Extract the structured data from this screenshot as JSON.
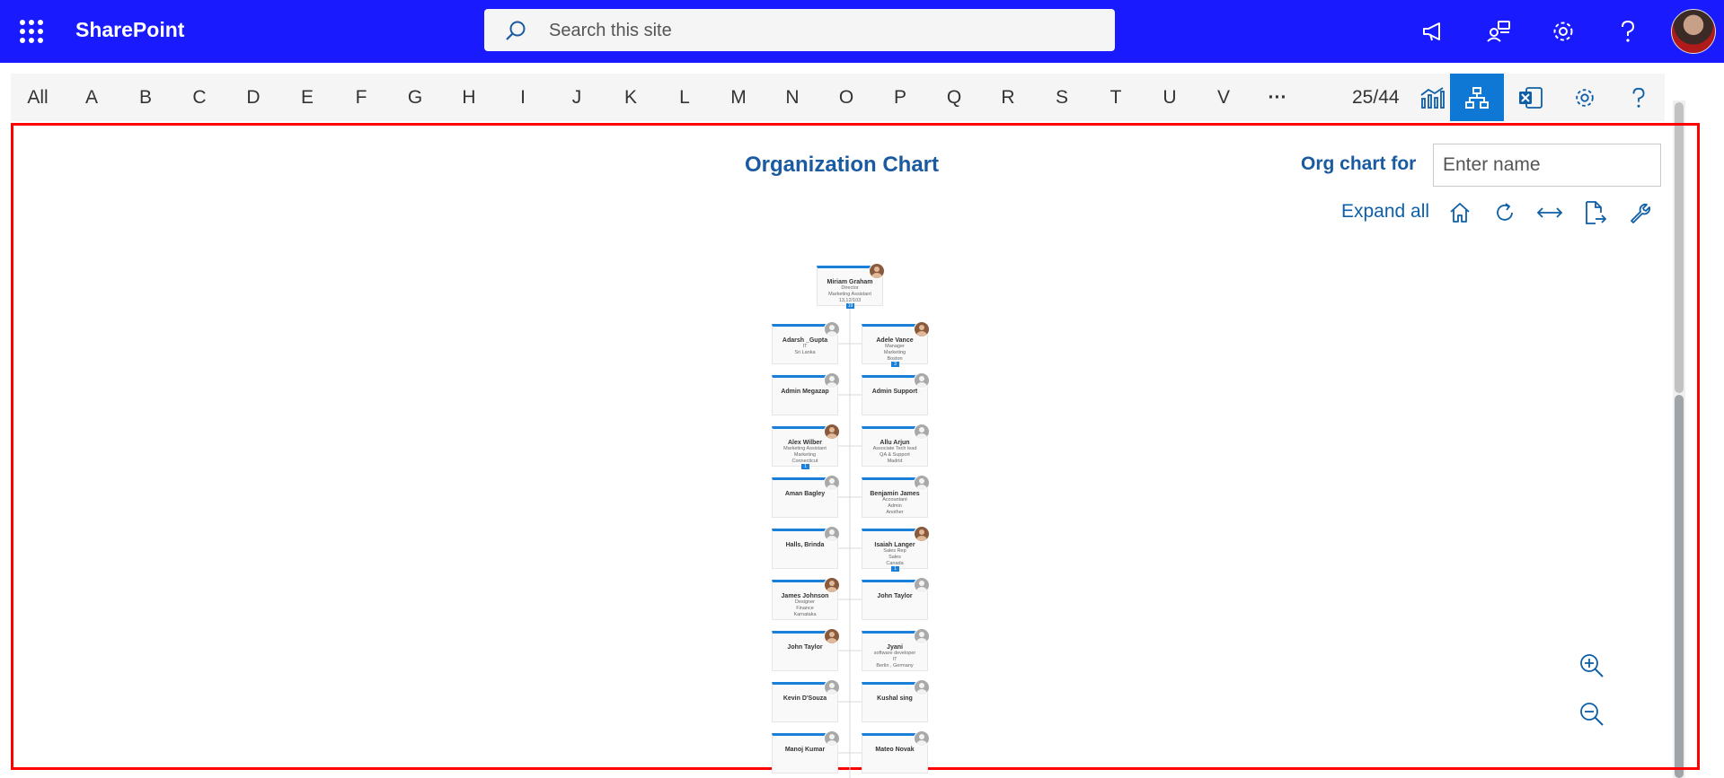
{
  "topbar": {
    "brand": "SharePoint",
    "search_placeholder": "Search this site",
    "icons": [
      "megaphone-icon",
      "share-people-icon",
      "settings-gear-icon",
      "help-icon",
      "user-avatar"
    ]
  },
  "alphabet": {
    "letters": [
      "All",
      "A",
      "B",
      "C",
      "D",
      "E",
      "F",
      "G",
      "H",
      "I",
      "J",
      "K",
      "L",
      "M",
      "N",
      "O",
      "P",
      "Q",
      "R",
      "S",
      "T",
      "U",
      "V",
      "···"
    ],
    "count": "25/44",
    "tools": [
      "analytics-icon",
      "org-chart-icon",
      "excel-icon",
      "settings-gear-icon",
      "help-icon"
    ],
    "active_tool": "org-chart-icon"
  },
  "orgchart": {
    "title": "Organization Chart",
    "org_chart_for_label": "Org chart for",
    "name_placeholder": "Enter name",
    "expand_all": "Expand all",
    "tools": [
      "home-icon",
      "refresh-icon",
      "fit-width-icon",
      "export-icon",
      "wrench-icon"
    ],
    "zoom": [
      "zoom-in-icon",
      "zoom-out-icon"
    ]
  },
  "chart_data": {
    "type": "table",
    "root": {
      "name": "Miriam Graham",
      "lines": [
        "Director",
        "Marketing Assistant",
        "13,12/103"
      ],
      "has_photo": true,
      "badge": "19"
    },
    "left_column": [
      {
        "name": "Adarsh _Gupta",
        "lines": [
          "IT",
          "Sri Lanka"
        ],
        "has_photo": false
      },
      {
        "name": "Admin Megazap",
        "lines": [],
        "has_photo": false
      },
      {
        "name": "Alex Wilber",
        "lines": [
          "Marketing Assistant",
          "Marketing",
          "Connecticut"
        ],
        "has_photo": true,
        "badge": "1"
      },
      {
        "name": "Aman Bagley",
        "lines": [],
        "has_photo": false
      },
      {
        "name": "Halls, Brinda",
        "lines": [],
        "has_photo": false
      },
      {
        "name": "James Johnson",
        "lines": [
          "Designer",
          "Finance",
          "Karnataka"
        ],
        "has_photo": true
      },
      {
        "name": "John Taylor",
        "lines": [],
        "has_photo": true
      },
      {
        "name": "Kevin D'Souza",
        "lines": [],
        "has_photo": false
      },
      {
        "name": "Manoj Kumar",
        "lines": [],
        "has_photo": false
      }
    ],
    "right_column": [
      {
        "name": "Adele Vance",
        "lines": [
          "Manager",
          "Marketing",
          "Boston"
        ],
        "has_photo": true,
        "badge": "3"
      },
      {
        "name": "Admin Support",
        "lines": [],
        "has_photo": false
      },
      {
        "name": "Allu Arjun",
        "lines": [
          "Associate Tech lead",
          "QA & Support",
          "Madrid"
        ],
        "has_photo": false
      },
      {
        "name": "Benjamin James",
        "lines": [
          "Accountant",
          "Admin",
          "Another"
        ],
        "has_photo": false
      },
      {
        "name": "Isaiah Langer",
        "lines": [
          "Sales Rep",
          "Sales",
          "Canada"
        ],
        "has_photo": true,
        "badge": "1"
      },
      {
        "name": "John Taylor",
        "lines": [],
        "has_photo": false
      },
      {
        "name": "Jyani",
        "lines": [
          "software developer",
          "IT",
          "Berlin , Germany"
        ],
        "has_photo": false
      },
      {
        "name": "Kushal sing",
        "lines": [],
        "has_photo": false
      },
      {
        "name": "Mateo Novak",
        "lines": [],
        "has_photo": false
      }
    ]
  }
}
